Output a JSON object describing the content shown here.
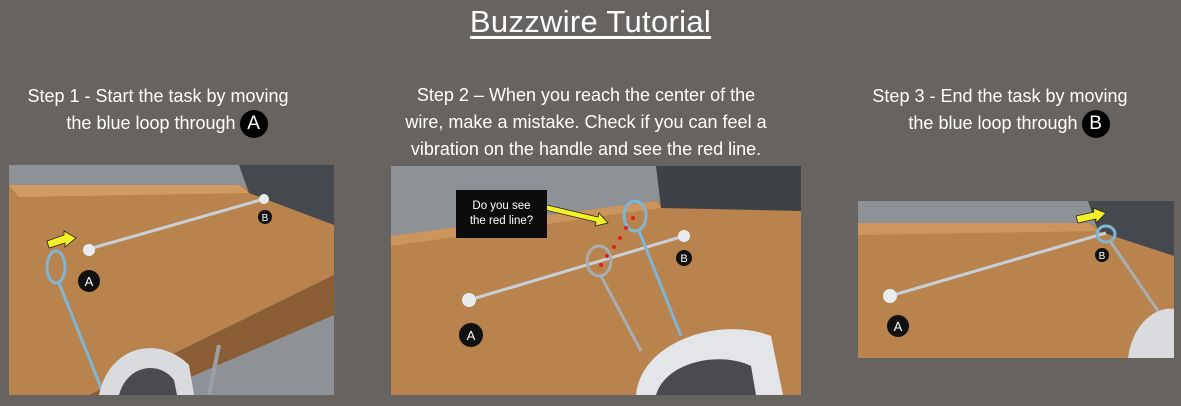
{
  "title": "Buzzwire Tutorial",
  "steps": [
    {
      "line1": "Step 1 - Start the task by moving",
      "line2": "the blue loop through",
      "badge": "A"
    },
    {
      "line1": "Step 2 – When you reach the center of the",
      "line2": "wire, make a mistake. Check if you can feel a",
      "line3": "vibration on the handle and see the red line."
    },
    {
      "line1": "Step 3 - End the task by moving",
      "line2": "the blue loop through",
      "badge": "B"
    }
  ],
  "callout": "Do you see\nthe red line?",
  "scene_labels": {
    "start": "A",
    "end": "B"
  },
  "colors": {
    "background": "#666360",
    "table": "#b9834e",
    "loop": "#7fb6d6",
    "arrow": "#f4f02a",
    "red_line": "#e02020"
  }
}
